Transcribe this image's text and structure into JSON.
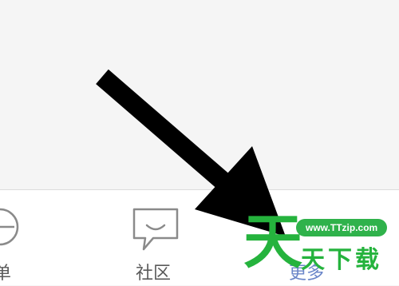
{
  "tab_bar": {
    "tabs": [
      {
        "label": "单",
        "icon": "circle-icon"
      },
      {
        "label": "社区",
        "icon": "chat-bubble-icon"
      },
      {
        "label": "更多",
        "icon": ""
      }
    ]
  },
  "overlay": {
    "arrow_color": "#000000"
  },
  "watermark": {
    "big_char": "天",
    "text": "天下载",
    "url": "www.TTzip.com",
    "color": "#25b33d"
  }
}
